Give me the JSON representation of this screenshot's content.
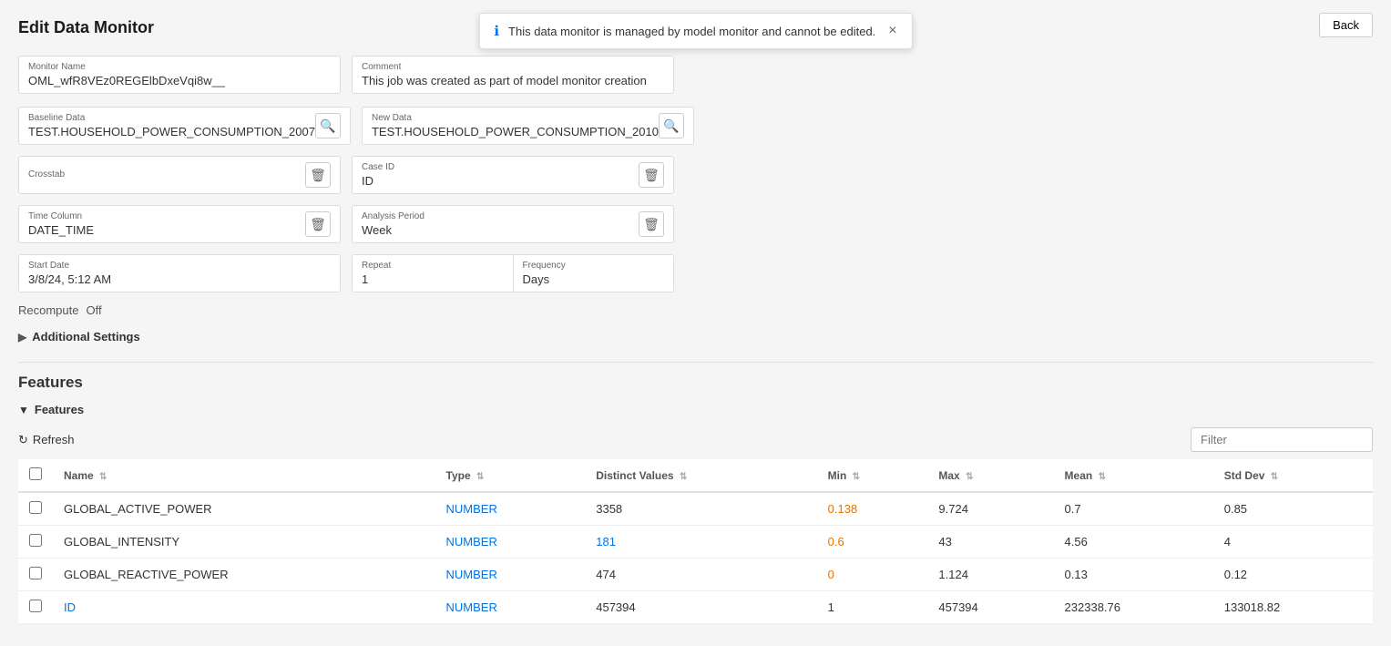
{
  "page": {
    "title": "Edit Data Monitor"
  },
  "toast": {
    "message": "This data monitor is managed by model monitor and cannot be edited.",
    "icon": "ℹ",
    "close": "×"
  },
  "back_button": "Back",
  "form": {
    "monitor_name_label": "Monitor Name",
    "monitor_name_value": "OML_wfR8VEz0REGElbDxeVqi8w__",
    "comment_label": "Comment",
    "comment_value": "This job was created as part of model monitor creation",
    "baseline_data_label": "Baseline Data",
    "baseline_data_value": "TEST.HOUSEHOLD_POWER_CONSUMPTION_2007",
    "new_data_label": "New Data",
    "new_data_value": "TEST.HOUSEHOLD_POWER_CONSUMPTION_2010",
    "crosstab_label": "Crosstab",
    "crosstab_value": "",
    "case_id_label": "Case ID",
    "case_id_value": "ID",
    "time_column_label": "Time Column",
    "time_column_value": "DATE_TIME",
    "analysis_period_label": "Analysis Period",
    "analysis_period_value": "Week",
    "start_date_label": "Start Date",
    "start_date_value": "3/8/24, 5:12 AM",
    "repeat_label": "Repeat",
    "repeat_value": "1",
    "frequency_label": "Frequency",
    "frequency_value": "Days"
  },
  "recompute": {
    "label": "Recompute",
    "value": "Off"
  },
  "additional_settings": {
    "label": "Additional Settings"
  },
  "features_section": {
    "title": "Features",
    "subtitle": "Features"
  },
  "toolbar": {
    "refresh_label": "Refresh",
    "filter_placeholder": "Filter"
  },
  "table": {
    "columns": [
      "Name",
      "Type",
      "Distinct Values",
      "Min",
      "Max",
      "Mean",
      "Std Dev"
    ],
    "rows": [
      {
        "name": "GLOBAL_ACTIVE_POWER",
        "type": "NUMBER",
        "distinct_values": "3358",
        "min": "0.138",
        "max": "9.724",
        "mean": "0.7",
        "std_dev": "0.85",
        "min_linked": true,
        "distinct_linked": false
      },
      {
        "name": "GLOBAL_INTENSITY",
        "type": "NUMBER",
        "distinct_values": "181",
        "min": "0.6",
        "max": "43",
        "mean": "4.56",
        "std_dev": "4",
        "min_linked": true,
        "distinct_linked": true
      },
      {
        "name": "GLOBAL_REACTIVE_POWER",
        "type": "NUMBER",
        "distinct_values": "474",
        "min": "0",
        "max": "1.124",
        "mean": "0.13",
        "std_dev": "0.12",
        "min_linked": true,
        "distinct_linked": false
      },
      {
        "name": "ID",
        "type": "NUMBER",
        "distinct_values": "457394",
        "min": "1",
        "max": "457394",
        "mean": "232338.76",
        "std_dev": "133018.82",
        "min_linked": false,
        "distinct_linked": false,
        "name_linked": true
      }
    ]
  }
}
